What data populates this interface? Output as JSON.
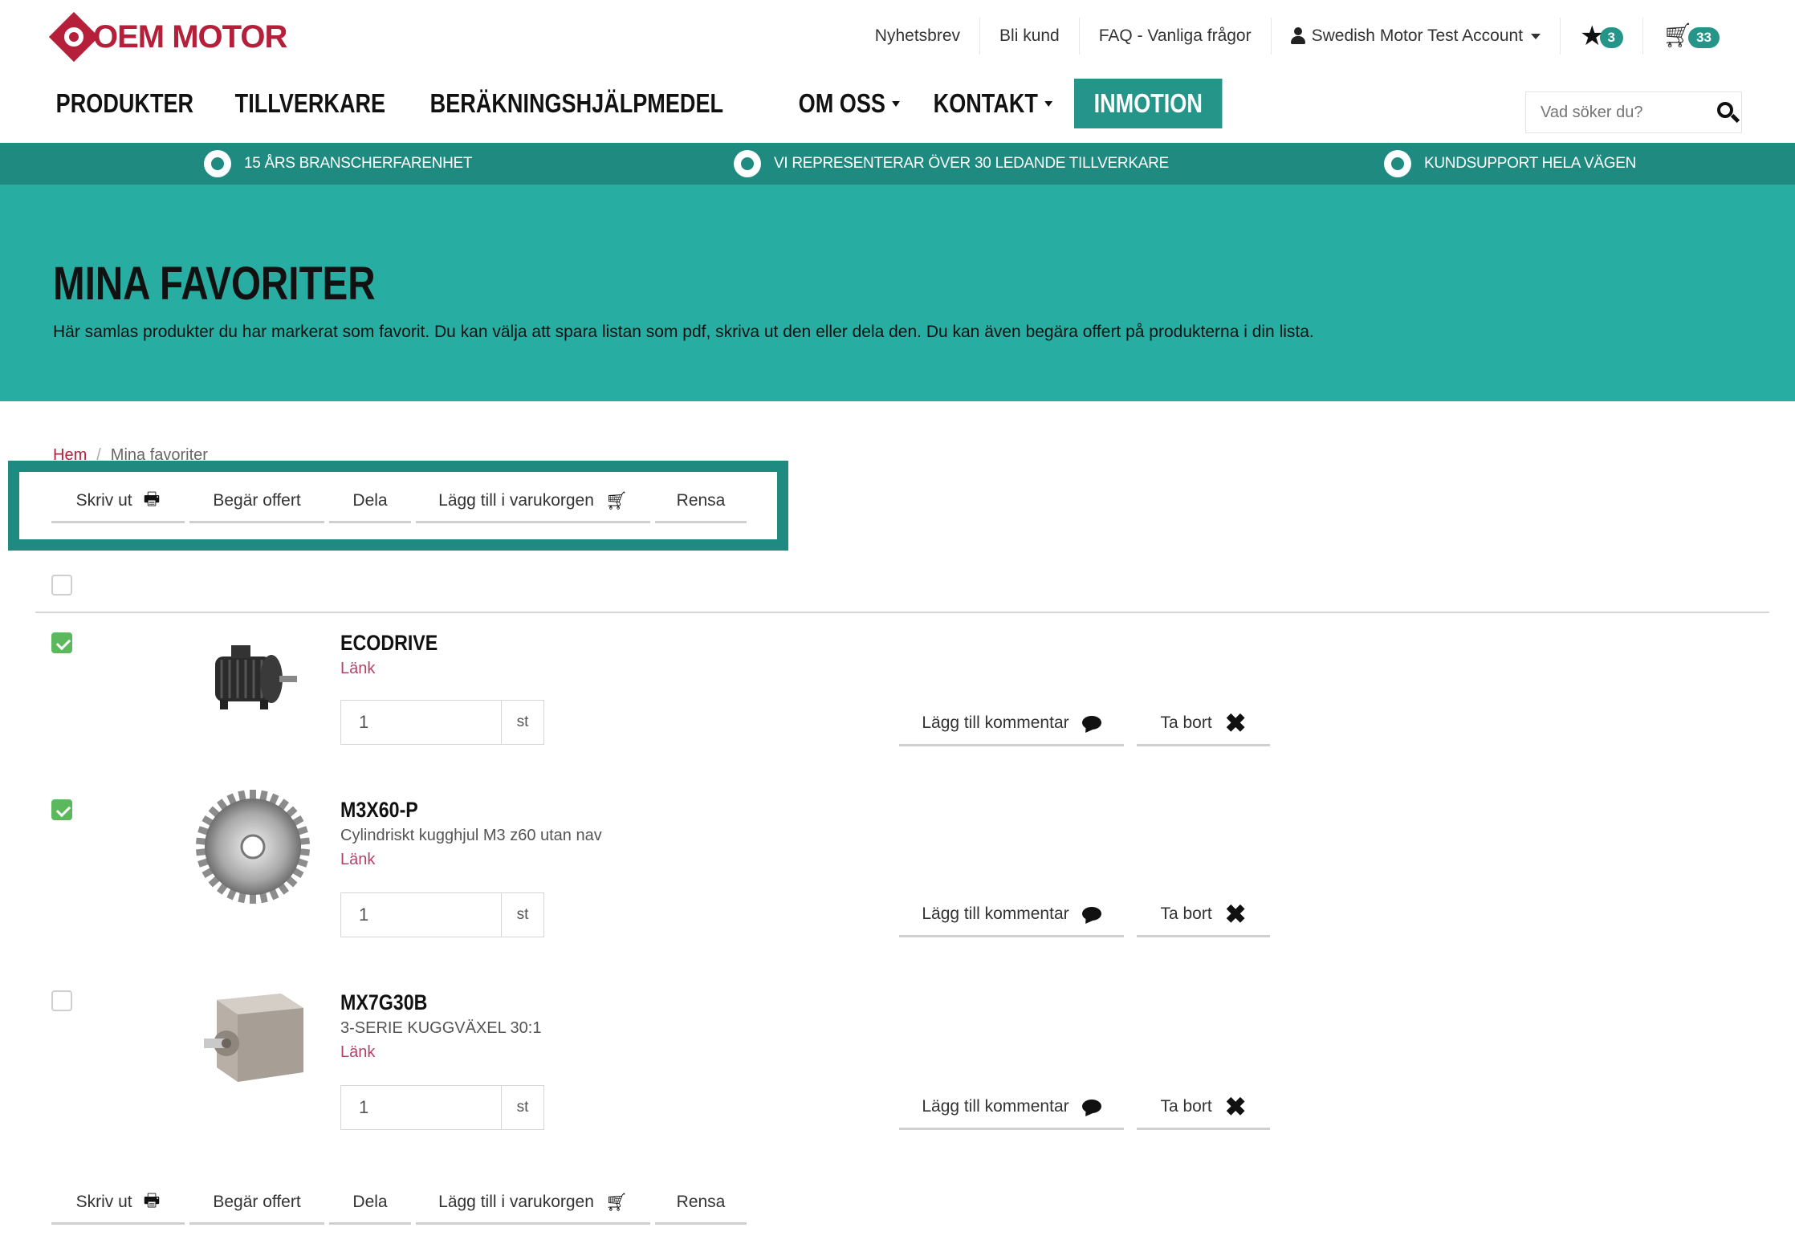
{
  "brand": {
    "name": "OEM MOTOR",
    "color": "#b51f3a",
    "accent": "#25958a"
  },
  "toplinks": {
    "newsletter": "Nyhetsbrev",
    "become_customer": "Bli kund",
    "faq": "FAQ - Vanliga frågor",
    "account": "Swedish Motor Test Account",
    "favorites_count": "3",
    "cart_count": "33"
  },
  "nav": {
    "items": [
      "PRODUKTER",
      "TILLVERKARE",
      "BERÄKNINGSHJÄLPMEDEL",
      "OM OSS",
      "KONTAKT",
      "INMOTION"
    ]
  },
  "search": {
    "placeholder": "Vad söker du?"
  },
  "strip": {
    "items": [
      "15 ÅRS BRANSCHERFARENHET",
      "VI REPRESENTERAR ÖVER 30 LEDANDE TILLVERKARE",
      "KUNDSUPPORT HELA VÄGEN"
    ]
  },
  "hero": {
    "title": "MINA FAVORITER",
    "text": "Här samlas produkter du har markerat som favorit. Du kan välja att spara listan som pdf, skriva ut den eller dela den. Du kan även begära offert på produkterna i din lista."
  },
  "breadcrumb": {
    "home": "Hem",
    "current": "Mina favoriter"
  },
  "toolbar": {
    "print": "Skriv ut",
    "quote": "Begär offert",
    "share": "Dela",
    "add_to_cart": "Lägg till i varukorgen",
    "clear": "Rensa"
  },
  "row_actions": {
    "comment": "Lägg till kommentar",
    "remove": "Ta bort"
  },
  "products": [
    {
      "name": "ECODRIVE",
      "description": "",
      "link": "Länk",
      "qty": "1",
      "unit": "st",
      "checked": true,
      "image": "electric-motor"
    },
    {
      "name": "M3X60-P",
      "description": "Cylindriskt kugghjul M3 z60 utan nav",
      "link": "Länk",
      "qty": "1",
      "unit": "st",
      "checked": true,
      "image": "spur-gear"
    },
    {
      "name": "MX7G30B",
      "description": "3-SERIE KUGGVÄXEL 30:1",
      "link": "Länk",
      "qty": "1",
      "unit": "st",
      "checked": false,
      "image": "gearbox"
    }
  ]
}
